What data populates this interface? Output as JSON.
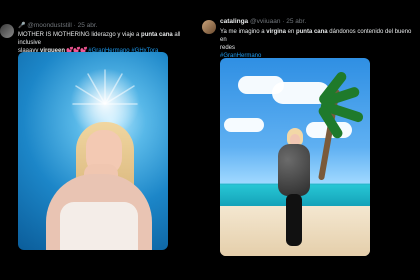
{
  "tweets": [
    {
      "side": "left",
      "header": {
        "emoji": "🎤",
        "handle": "@moonduststill",
        "dot": "·",
        "date": "25 abr."
      },
      "body": {
        "line1_prefix": "MOTHER IS MOTHERING liderazgo y viaje a ",
        "line1_bold": "punta cana",
        "line1_suffix": " all inclusive",
        "line2_prefix": "slaaayy ",
        "line2_bold": "virqueen",
        "line2_hearts": " 💕💕💕 ",
        "hashtags": [
          "#GranHermano",
          "#GHxTora"
        ]
      },
      "media": {
        "semantic": "blonde woman portrait with halo light"
      }
    },
    {
      "side": "right",
      "header": {
        "display_name": "catalinga",
        "handle": "@vviiuaan",
        "dot": "·",
        "date": "25 abr."
      },
      "body": {
        "line1_prefix": "Ya me imagino a ",
        "line1_bold_1": "virgina",
        "line1_mid": " en ",
        "line1_bold_2": "punta cana",
        "line1_suffix": " dándonos contenido del bueno en",
        "line2": "redes",
        "hashtags": [
          "#GranHermano"
        ]
      },
      "media": {
        "semantic": "woman posing on tropical beach with palm trees"
      }
    }
  ],
  "colors": {
    "background": "#000000",
    "text": "#e7e9ea",
    "muted": "#71767b",
    "hashtag": "#1d9bf0"
  }
}
